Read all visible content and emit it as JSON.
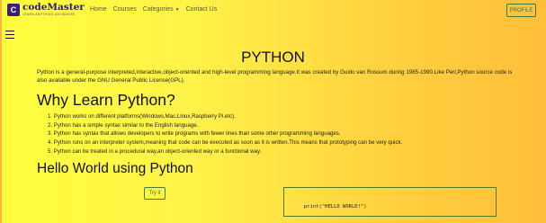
{
  "brand": {
    "logo_glyph": "C",
    "name": "codeMaster",
    "tagline": "LEARN ANYTHING ANYWHERE"
  },
  "nav": {
    "links": [
      "Home",
      "Courses",
      "Categories",
      "Contact Us"
    ],
    "profile_label": "PROFILE"
  },
  "main": {
    "title": "PYTHON",
    "intro": "Python is a general-purpose interpreted,interactive,object-oriented and high-level programming language.It was created by Guido van Rossum during 1985-1990.Like Perl,Python source code is also available under the GNU General Public License(GPL).",
    "why_heading": "Why Learn Python?",
    "reasons": [
      "1. Python works on different platforms(Windows,Mac,Linux,Raspberry Pi,etc).",
      "2. Python has a simple syntax similar to the English language.",
      "3. Python has syntax that allows developers to write programs with fewer lines than some other programming languages.",
      "4. Python runs on an interpreter system,meaning that code can be executed as soon as it is written.This means that prototyping can be very quick.",
      "5. Python can be treated in a procedural way,an object-oriented way or a functional way."
    ],
    "hello_heading": "Hello World using Python",
    "try_label": "Try it",
    "code": "print(\"HELLO WORLD!\")"
  },
  "icons": {
    "menu": "hamburger-menu-icon",
    "dropdown": "caret-down-icon"
  },
  "colors": {
    "gradient_start": "#ffff3d",
    "gradient_end": "#ffbe3a",
    "button_green": "#3b7a3b",
    "brand_purple": "#2b1a5c"
  }
}
